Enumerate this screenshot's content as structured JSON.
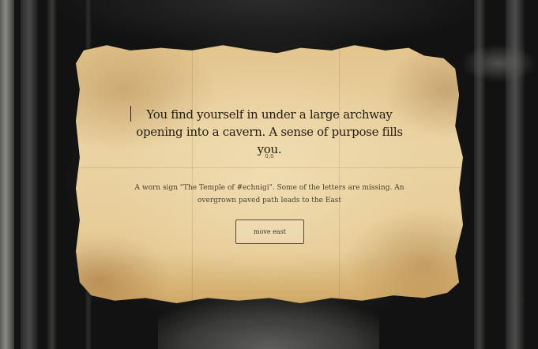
{
  "story": {
    "headline": "You find yourself in under a large archway opening into a cavern. A sense of purpose fills you.",
    "marker": "0,0",
    "description": "A worn sign \"The Temple of #echnigi\". Some of the letters are missing. An overgrown paved path leads to the East"
  },
  "actions": [
    {
      "label": "move east"
    }
  ],
  "colors": {
    "parchment": "#e8cf9c",
    "ink": "#231d12",
    "background": "#1a1a1a"
  }
}
